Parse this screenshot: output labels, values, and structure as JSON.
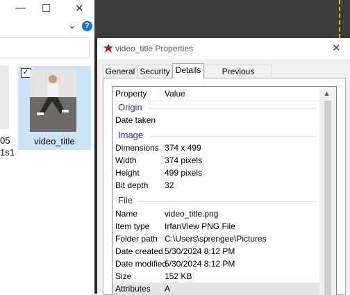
{
  "explorer": {
    "minimize_glyph": "—",
    "maximize_glyph": "☐",
    "close_glyph": "✕",
    "chevron_glyph": "⌄",
    "help_glyph": "?",
    "partial_label_1": "05",
    "partial_label_2": "1s1",
    "file": {
      "name": "video_title",
      "checkbox": "✓"
    }
  },
  "dialog": {
    "title": "video_title Properties",
    "close_glyph": "✕",
    "tabs": [
      "General",
      "Security",
      "Details",
      "Previous Versions"
    ],
    "active_tab": "Details",
    "columns": {
      "property": "Property",
      "value": "Value"
    },
    "groups": {
      "origin": {
        "title": "Origin",
        "rows": [
          {
            "k": "Date taken",
            "v": ""
          }
        ]
      },
      "image": {
        "title": "Image",
        "rows": [
          {
            "k": "Dimensions",
            "v": "374 x 499"
          },
          {
            "k": "Width",
            "v": "374 pixels"
          },
          {
            "k": "Height",
            "v": "499 pixels"
          },
          {
            "k": "Bit depth",
            "v": "32"
          }
        ]
      },
      "file": {
        "title": "File",
        "rows": [
          {
            "k": "Name",
            "v": "video_title.png"
          },
          {
            "k": "Item type",
            "v": "IrfanView PNG File"
          },
          {
            "k": "Folder path",
            "v": "C:\\Users\\sprengee\\Pictures"
          },
          {
            "k": "Date created",
            "v": "5/30/2024 8:12 PM"
          },
          {
            "k": "Date modified",
            "v": "5/30/2024 8:12 PM"
          },
          {
            "k": "Size",
            "v": "152 KB"
          },
          {
            "k": "Attributes",
            "v": "A"
          }
        ]
      }
    },
    "scroll_up_glyph": "▲"
  },
  "colors": {
    "group_header": "#1e3287",
    "help_blue": "#1a6fd0",
    "selection": "#cce4f7"
  }
}
